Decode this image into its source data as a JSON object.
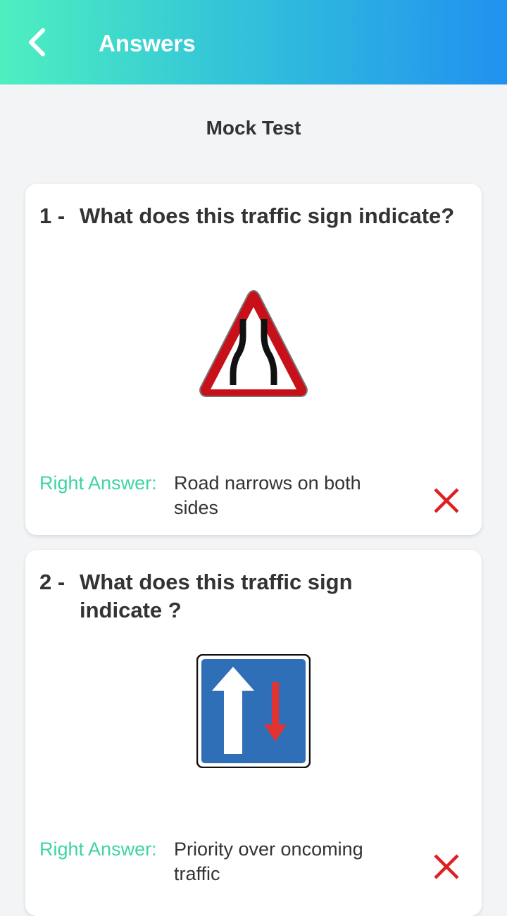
{
  "header": {
    "title": "Answers",
    "back_icon": "chevron-left-icon",
    "gradient_start": "#4ef0c0",
    "gradient_end": "#2191f0"
  },
  "subtitle": "Mock Test",
  "answer_label": "Right Answer:",
  "colors": {
    "accent_green": "#3dd5a2",
    "wrong_red": "#e02020",
    "sign_red": "#c8101a",
    "sign_blue": "#2f6fb8"
  },
  "questions": [
    {
      "number": "1 -",
      "text": "What does this traffic sign indicate?",
      "sign_icon": "road-narrows-both-sides-sign",
      "right_answer": "Road narrows on both sides",
      "result_icon": "wrong-x-icon"
    },
    {
      "number": "2 -",
      "text": "What does this traffic sign indicate ?",
      "sign_icon": "priority-over-oncoming-traffic-sign",
      "right_answer": "Priority over oncoming traffic",
      "result_icon": "wrong-x-icon"
    }
  ]
}
